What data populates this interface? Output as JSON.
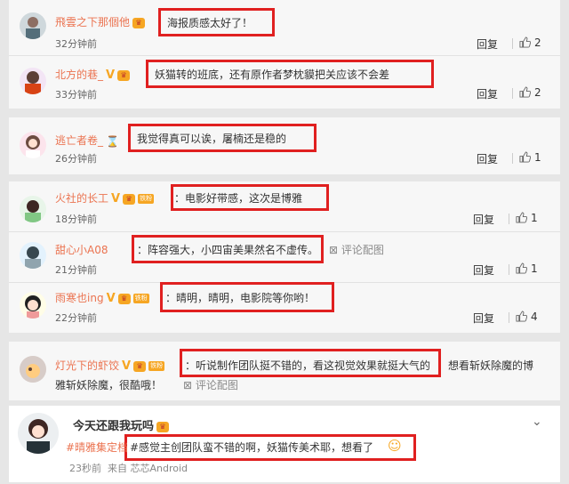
{
  "labels": {
    "reply": "回复",
    "view_pic": "评论配图",
    "more_reply_text": "想看斩妖除魔的博"
  },
  "comments": [
    {
      "user": "飛雲之下那個他",
      "text": "海报质感太好了！",
      "time": "32分钟前",
      "likes": "2"
    },
    {
      "user": "北方的巷_",
      "text": "妖猫转的班底，还有原作者梦枕貘把关应该不会差",
      "time": "33分钟前",
      "likes": "2"
    },
    {
      "user": "逃亡者卷_",
      "text": "我觉得真可以诶，屠楠还是稳的",
      "time": "26分钟前",
      "likes": "1"
    },
    {
      "user": "火社的长工",
      "text": "：电影好带感，这次是博雅",
      "time": "18分钟前",
      "likes": "1"
    },
    {
      "user": "甜心小A08",
      "text": "：阵容强大，小四宙美果然名不虚传。",
      "time": "21分钟前",
      "likes": "1"
    },
    {
      "user": "雨寒也ing",
      "text": "：晴明，晴明，电影院等你哟！",
      "time": "22分钟前",
      "likes": "4"
    },
    {
      "user": "灯光下的虾饺",
      "text": "：听说制作团队挺不错的，看这视觉效果就挺大气的",
      "text_tail": "想看斩妖除魔的博",
      "text_line2": "雅斩妖除魔，很酷哦！"
    }
  ],
  "post": {
    "user": "今天还跟我玩吗",
    "hashtag": "#晴雅集定档",
    "text": "#感觉主创团队蛮不错的啊，妖猫传美术耶，想看了",
    "time": "23秒前",
    "source": "来自 芯芯Android"
  },
  "colors": {
    "name": "#eb7350",
    "highlight": "#e02020",
    "hashtag": "#eb7350"
  }
}
